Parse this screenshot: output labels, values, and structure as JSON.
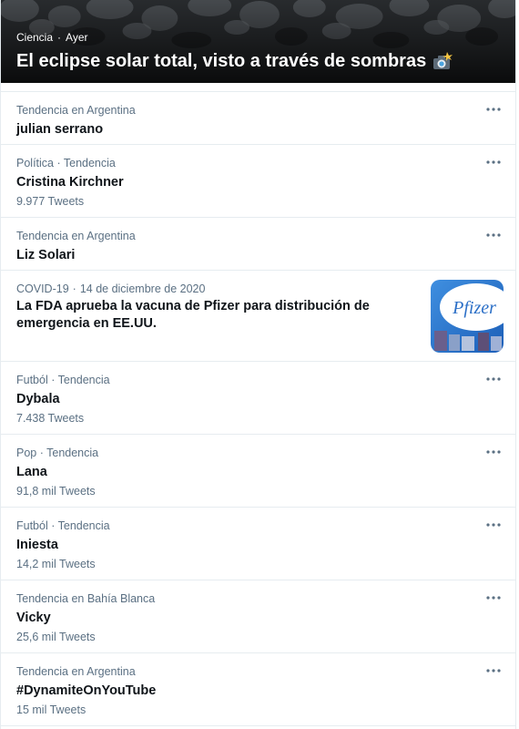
{
  "hero": {
    "category": "Ciencia",
    "time": "Ayer",
    "title": "El eclipse solar total, visto a través de sombras",
    "emoji_icon": "camera-flash-icon"
  },
  "news": {
    "category": "COVID-19",
    "date": "14 de diciembre de 2020",
    "title": "La FDA aprueba la vacuna de Pfizer para distribución de emergencia en EE.UU.",
    "thumbnail_text": "Pfizer"
  },
  "trends": [
    {
      "context": "Tendencia en Argentina",
      "name": "julian serrano",
      "count": ""
    },
    {
      "context": "Política · Tendencia",
      "name": "Cristina Kirchner",
      "count": "9.977 Tweets"
    }
  ],
  "trends_after_news": [
    {
      "context": "Tendencia en Argentina",
      "name": "Liz Solari",
      "count": ""
    }
  ],
  "trends_bottom": [
    {
      "context": "Futból · Tendencia",
      "name": "Dybala",
      "count": "7.438 Tweets"
    },
    {
      "context": "Pop · Tendencia",
      "name": "Lana",
      "count": "91,8 mil Tweets"
    },
    {
      "context": "Futból · Tendencia",
      "name": "Iniesta",
      "count": "14,2 mil Tweets"
    },
    {
      "context": "Tendencia en Bahía Blanca",
      "name": "Vicky",
      "count": "25,6 mil Tweets"
    },
    {
      "context": "Tendencia en Argentina",
      "name": "#DynamiteOnYouTube",
      "count": "15 mil Tweets"
    }
  ],
  "colors": {
    "secondary_text": "#5b7083",
    "primary_text": "#0f1419",
    "divider": "#e6ecf0",
    "more_icon": "#5b7083"
  },
  "more_icon": "more-options-icon"
}
